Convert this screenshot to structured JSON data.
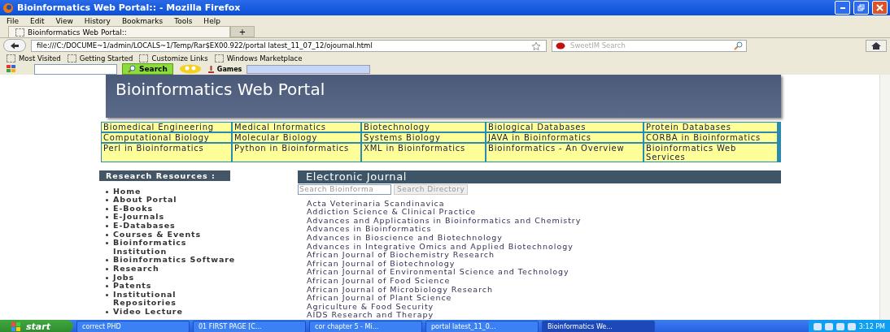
{
  "window": {
    "title": "Bioinformatics Web Portal:: - Mozilla Firefox"
  },
  "menu": [
    "File",
    "Edit",
    "View",
    "History",
    "Bookmarks",
    "Tools",
    "Help"
  ],
  "tabs": [
    {
      "label": "Bioinformatics Web Portal::",
      "selected": true
    }
  ],
  "new_tab": "+",
  "address": {
    "value": "file:///C:/DOCUME~1/admin/LOCALS~1/Temp/Rar$EX00.922/portal latest_11_07_12/ojournal.html"
  },
  "search": {
    "placeholder": "SweetIM Search"
  },
  "bookmarks": [
    "Most Visited",
    "Getting Started",
    "Customize Links",
    "Windows Marketplace"
  ],
  "toolbar": {
    "search_button": "Search",
    "games_button": "Games"
  },
  "page": {
    "title": "Bioinformatics Web Portal",
    "nav": [
      [
        "Biomedical Engineering",
        "Medical Informatics",
        "Biotechnology",
        "Biological Databases",
        "Protein Databases"
      ],
      [
        "Computational Biology",
        "Molecular Biology",
        "Systems Biology",
        "JAVA in Bioinformatics",
        "CORBA in Bioinformatics"
      ],
      [
        "Perl  in Bioinformatics",
        "Python in Bioinformatics",
        "XML in Bioinformatics",
        "Bioinformatics - An Overview",
        "Bioinformatics Web Services"
      ]
    ],
    "sidebar": {
      "title": "Research Resources :",
      "items": [
        "Home",
        "About Portal",
        "E-Books",
        "E-Journals",
        "E-Databases",
        "Courses & Events",
        "Bioinformatics Institution",
        "Bioinformatics Software",
        "Research",
        "Jobs",
        "Patents",
        "Institutional Repositories",
        "Video Lecture"
      ]
    },
    "main": {
      "title": "Electronic Journal",
      "search_value": "Search Bioinforma",
      "search_button": "Search Directory",
      "journals": [
        "Acta Veterinaria Scandinavica",
        "Addiction Science & Clinical Practice",
        "Advances and Applications in Bioinformatics and Chemistry",
        "Advances in Bioinformatics",
        "Advances in Bioscience and Biotechnology",
        "Advances in Integrative Omics and Applied Biotechnology",
        "African Journal of Biochemistry Research",
        "African Journal of Biotechnology",
        "African Journal of Environmental Science and Technology",
        "African Journal of Food Science",
        "African Journal of Microbiology Research",
        "African Journal of Plant Science",
        "Agriculture & Food Security",
        "AIDS Research and Therapy"
      ]
    }
  },
  "taskbar": {
    "start": "start",
    "tasks": [
      {
        "label": "correct PHD",
        "selected": false
      },
      {
        "label": "01 FIRST PAGE [C...",
        "selected": false
      },
      {
        "label": "cor chapter 5 - Mi...",
        "selected": false
      },
      {
        "label": "portal latest_11_0...",
        "selected": false
      },
      {
        "label": "Bioinformatics We...",
        "selected": true
      }
    ],
    "time": "3:12 PM"
  }
}
